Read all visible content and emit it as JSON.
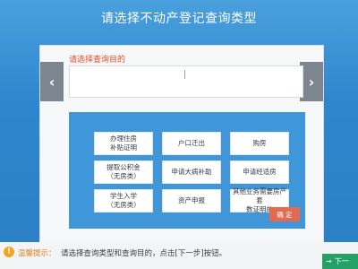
{
  "page": {
    "title": "请选择不动产登记查询类型"
  },
  "purpose": {
    "label": "请选择查询目的",
    "value": ""
  },
  "nav": {
    "prev_icon": "‹",
    "next_icon": "›"
  },
  "types": [
    "办理住房\n补贴证明",
    "户口迁出",
    "购房",
    "提取公积金\n（无房类）",
    "申请大病补助",
    "申请经适房",
    "学生入学\n（无房类）",
    "资产申报",
    "其他业务需要房产套\n数证明的"
  ],
  "confirm": {
    "label": "确 定"
  },
  "hint": {
    "icon": "!",
    "title": "温馨提示：",
    "text": "请选择查询类型和查询目的，点击[下一步]按钮。"
  },
  "next": {
    "label": "下一",
    "icon": "→"
  },
  "colors": {
    "header_blue": "#3a8fd3",
    "grid_blue": "#3f97d9",
    "label_red": "#e24c2c",
    "confirm_red": "#e46a4f",
    "next_green": "#25a167",
    "hint_orange": "#f2a421"
  }
}
